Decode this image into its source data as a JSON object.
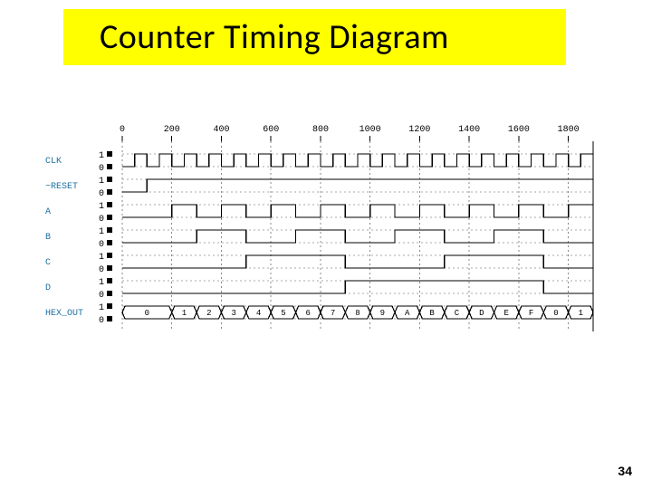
{
  "title": "Counter Timing Diagram",
  "page_number": "34",
  "chart_data": {
    "type": "timing",
    "time_axis": {
      "start": 0,
      "end": 1900,
      "ticks": [
        0,
        200,
        400,
        600,
        800,
        1000,
        1200,
        1400,
        1600,
        1800
      ]
    },
    "clk_period": 100,
    "signals": [
      {
        "name": "CLK",
        "levels": [
          "1",
          "0"
        ],
        "type": "clock",
        "period": 100
      },
      {
        "name": "~RESET",
        "levels": [
          "1",
          "0"
        ],
        "type": "bit",
        "transitions": [
          [
            0,
            0
          ],
          [
            100,
            1
          ]
        ]
      },
      {
        "name": "A",
        "levels": [
          "1",
          "0"
        ],
        "type": "bit",
        "toggle_at": [
          200,
          300,
          400,
          500,
          600,
          700,
          800,
          900,
          1000,
          1100,
          1200,
          1300,
          1400,
          1500,
          1600,
          1700,
          1800
        ],
        "initial": 0
      },
      {
        "name": "B",
        "levels": [
          "1",
          "0"
        ],
        "type": "bit",
        "toggle_at": [
          300,
          500,
          700,
          900,
          1100,
          1300,
          1500,
          1700
        ],
        "initial": 0
      },
      {
        "name": "C",
        "levels": [
          "1",
          "0"
        ],
        "type": "bit",
        "toggle_at": [
          500,
          900,
          1300,
          1700
        ],
        "initial": 0
      },
      {
        "name": "D",
        "levels": [
          "1",
          "0"
        ],
        "type": "bit",
        "toggle_at": [
          900,
          1700
        ],
        "initial": 0
      },
      {
        "name": "HEX_OUT",
        "levels": [
          "1",
          "0"
        ],
        "type": "bus",
        "values": [
          "0",
          "1",
          "2",
          "3",
          "4",
          "5",
          "6",
          "7",
          "8",
          "9",
          "A",
          "B",
          "C",
          "D",
          "E",
          "F",
          "0",
          "1"
        ],
        "change_times": [
          0,
          200,
          300,
          400,
          500,
          600,
          700,
          800,
          900,
          1000,
          1100,
          1200,
          1300,
          1400,
          1500,
          1600,
          1700,
          1800
        ]
      }
    ]
  }
}
